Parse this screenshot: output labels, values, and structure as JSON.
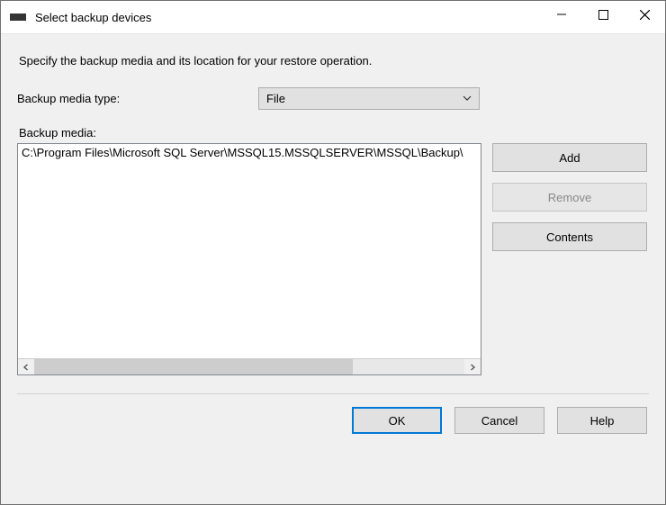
{
  "window": {
    "title": "Select backup devices"
  },
  "instruction": "Specify the backup media and its location for your restore operation.",
  "media_type": {
    "label": "Backup media type:",
    "value": "File"
  },
  "media_list": {
    "label": "Backup media:",
    "items": [
      "C:\\Program Files\\Microsoft SQL Server\\MSSQL15.MSSQLSERVER\\MSSQL\\Backup\\"
    ]
  },
  "buttons": {
    "add": "Add",
    "remove": "Remove",
    "contents": "Contents",
    "ok": "OK",
    "cancel": "Cancel",
    "help": "Help"
  }
}
